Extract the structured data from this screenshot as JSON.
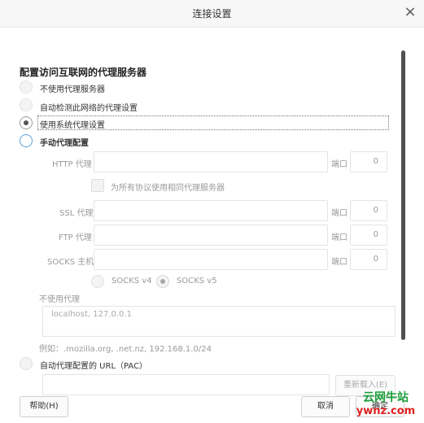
{
  "window": {
    "title": "连接设置",
    "close_glyph": "×"
  },
  "section": {
    "title": "配置访问互联网的代理服务器"
  },
  "options": {
    "no_proxy": "不使用代理服务器",
    "auto_detect": "自动检测此网络的代理设置",
    "system_proxy": "使用系统代理设置",
    "manual_proxy": "手动代理配置",
    "selected": "system_proxy"
  },
  "manual": {
    "http_label": "HTTP 代理",
    "http_value": "",
    "http_port_label": "端口",
    "http_port": "0",
    "same_for_all_label": "为所有协议使用相同代理服务器",
    "ssl_label": "SSL 代理",
    "ssl_value": "",
    "ssl_port_label": "端口",
    "ssl_port": "0",
    "ftp_label": "FTP 代理",
    "ftp_value": "",
    "ftp_port_label": "端口",
    "ftp_port": "0",
    "socks_label": "SOCKS 主机",
    "socks_value": "",
    "socks_port_label": "端口",
    "socks_port": "0",
    "socks_v4": "SOCKS v4",
    "socks_v5": "SOCKS v5",
    "socks_selected": "v5"
  },
  "no_proxy": {
    "label": "不使用代理",
    "value": "localhost, 127.0.0.1",
    "example": "例如：.mozilla.org, .net.nz, 192.168.1.0/24"
  },
  "pac": {
    "label": "自动代理配置的 URL（PAC）",
    "value": "",
    "reload_button": "重新载入(E)"
  },
  "footer": {
    "help_button": "帮助(H)",
    "cancel_button": "取消",
    "ok_button": "确定"
  },
  "watermark": {
    "line1": "云网牛站",
    "line2": "ywnz.com"
  },
  "colors": {
    "focus_ring": "#5aa0d8",
    "watermark_green": "#1aa03a",
    "watermark_red": "#dd2222"
  }
}
